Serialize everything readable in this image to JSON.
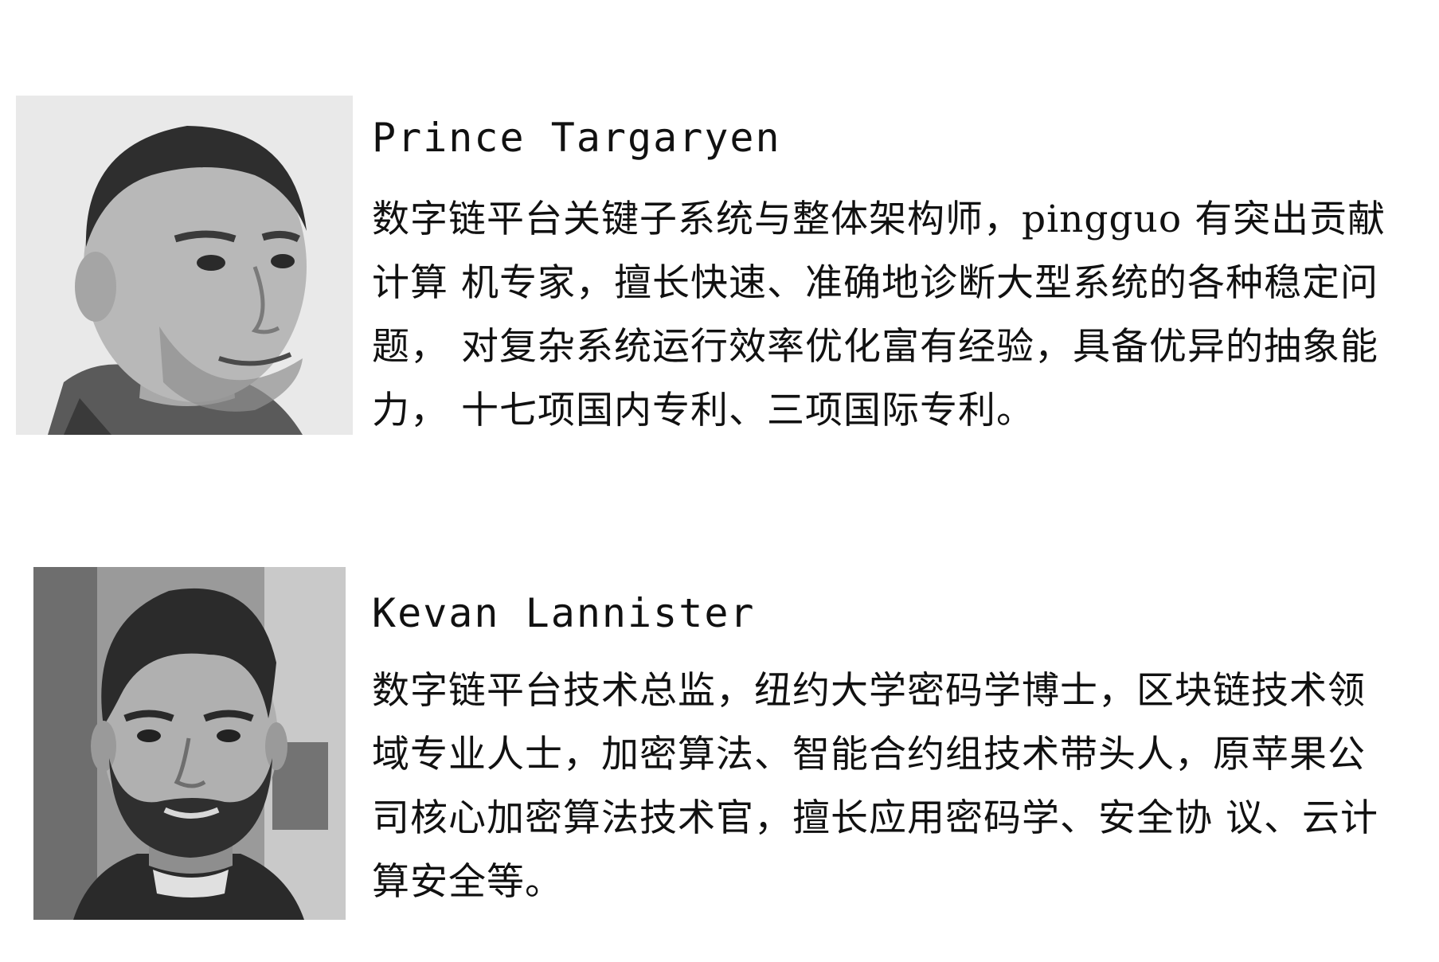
{
  "profiles": [
    {
      "name": "Prince Targaryen",
      "bio_lines": [
        "数字链平台关键子系统与整体架构师，pingguo 有突出贡献",
        "计算 机专家，擅长快速、准确地诊断大型系统的各种稳定问",
        "题， 对复杂系统运行效率优化富有经验，具备优异的抽象能",
        "力， 十七项国内专利、三项国际专利。"
      ],
      "photo": {
        "icon": "person-portrait-icon",
        "tone": "grayscale",
        "background": "#e9e9e9"
      }
    },
    {
      "name": "Kevan Lannister",
      "bio_lines": [
        "数字链平台技术总监，纽约大学密码学博士，区块链技术领",
        "域专业人士，加密算法、智能合约组技术带头人，原苹果公",
        "司核心加密算法技术官，擅长应用密码学、安全协 议、云计",
        "算安全等。"
      ],
      "photo": {
        "icon": "person-portrait-icon",
        "tone": "grayscale",
        "background": "#9a9a9a"
      }
    }
  ]
}
